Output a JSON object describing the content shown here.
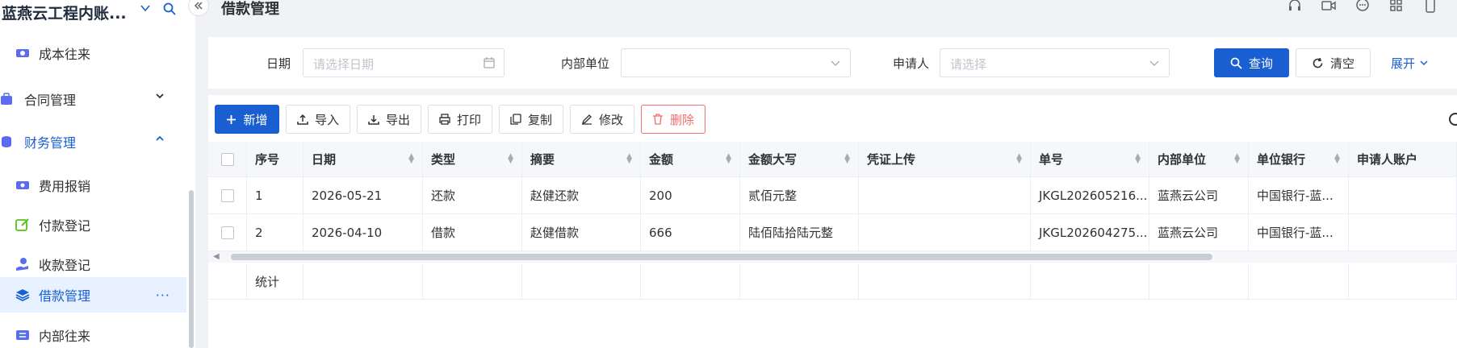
{
  "app": {
    "title": "蓝燕云工程内账...",
    "page_title": "借款管理"
  },
  "sidebar": {
    "items": [
      {
        "label": "成本往来",
        "icon": "money-exchange-icon"
      },
      {
        "label": "合同管理",
        "icon": "briefcase-icon"
      },
      {
        "label": "财务管理",
        "icon": "coins-icon"
      },
      {
        "label": "费用报销",
        "icon": "cash-icon"
      },
      {
        "label": "付款登记",
        "icon": "edit-note-icon"
      },
      {
        "label": "收款登记",
        "icon": "hand-coin-icon"
      },
      {
        "label": "借款管理",
        "icon": "layers-icon"
      },
      {
        "label": "内部往来",
        "icon": "transfer-icon"
      }
    ],
    "more_label": "···"
  },
  "filter": {
    "date_label": "日期",
    "date_placeholder": "请选择日期",
    "unit_label": "内部单位",
    "unit_value": "",
    "applicant_label": "申请人",
    "applicant_placeholder": "请选择",
    "query_label": "查询",
    "clear_label": "清空",
    "expand_label": "展开"
  },
  "toolbar": {
    "add": "新增",
    "import": "导入",
    "export": "导出",
    "print": "打印",
    "copy": "复制",
    "modify": "修改",
    "delete": "删除"
  },
  "table": {
    "columns": [
      "序号",
      "日期",
      "类型",
      "摘要",
      "金额",
      "金额大写",
      "凭证上传",
      "单号",
      "内部单位",
      "单位银行",
      "申请人账户"
    ],
    "rows": [
      [
        "1",
        "2026-05-21",
        "还款",
        "赵健还款",
        "200",
        "贰佰元整",
        "",
        "JKGL202605216...",
        "蓝燕云公司",
        "中国银行-蓝...",
        ""
      ],
      [
        "2",
        "2026-04-10",
        "借款",
        "赵健借款",
        "666",
        "陆佰陆拾陆元整",
        "",
        "JKGL202604275...",
        "蓝燕云公司",
        "中国银行-蓝...",
        ""
      ]
    ],
    "summary_label": "统计"
  },
  "colors": {
    "primary": "#1a5fd1",
    "danger": "#f56c6c",
    "active_bg": "#e8f1ff"
  }
}
